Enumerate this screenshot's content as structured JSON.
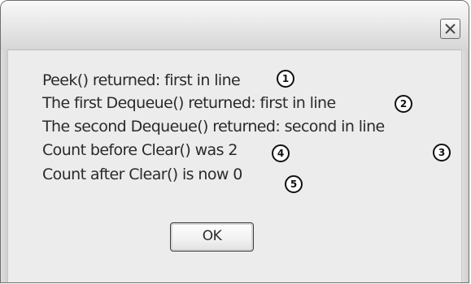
{
  "dialog": {
    "lines": [
      "Peek() returned: first in line",
      "The first Dequeue() returned: first in line",
      "The second Dequeue() returned: second in line",
      "Count before Clear() was 2",
      "Count after Clear() is now 0"
    ],
    "callouts": [
      "1",
      "2",
      "3",
      "4",
      "5"
    ],
    "ok_label": "OK"
  },
  "icons": {
    "close": "close-icon"
  }
}
